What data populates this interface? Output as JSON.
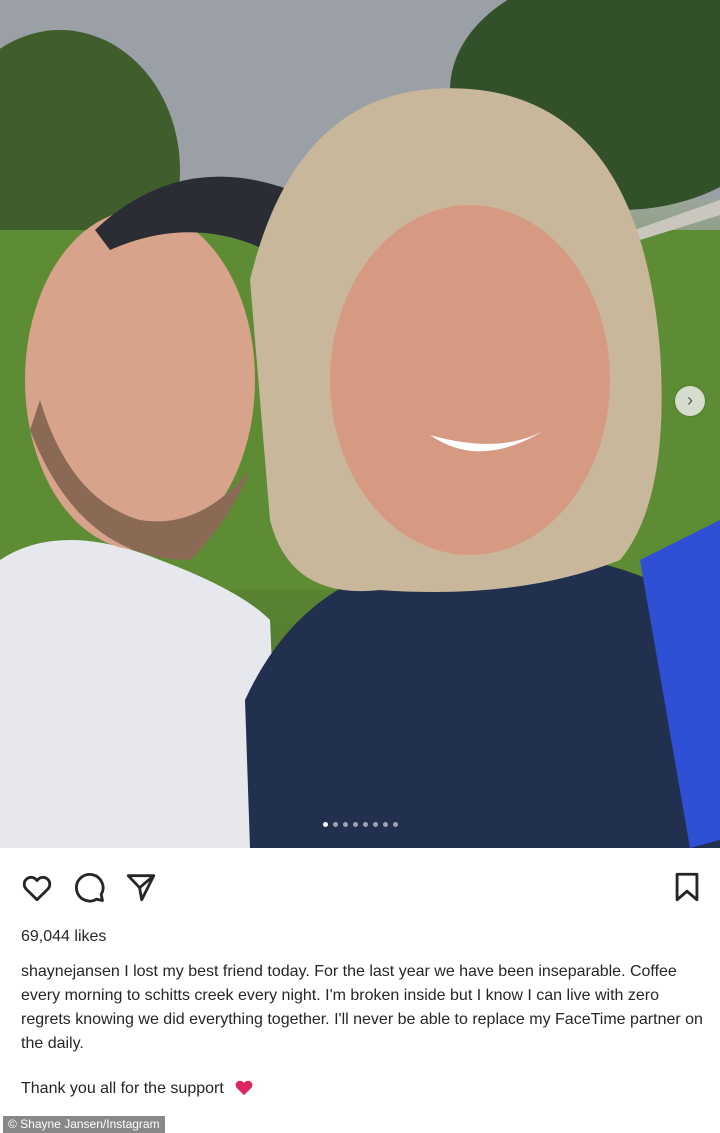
{
  "post": {
    "likes": "69,044 likes",
    "username": "shaynejansen",
    "caption": "I lost my best friend today. For the last year we have been inseparable. Coffee every morning to schitts creek every night. I'm broken inside but I know I can live with zero regrets knowing we did everything together. I'll never be able to replace my FaceTime partner on the daily.",
    "thanks": "Thank you all for the support",
    "carousel": {
      "count": 8,
      "active_index": 0
    }
  },
  "icons": {
    "like": "heart-outline-icon",
    "comment": "comment-bubble-icon",
    "share": "paper-plane-icon",
    "save": "bookmark-icon",
    "next": "chevron-right-icon",
    "emoji": "red-heart-emoji"
  },
  "photo_credit": "© Shayne Jansen/Instagram",
  "colors": {
    "text": "#262626",
    "heart": "#e0245e",
    "credit_bg": "#888888"
  }
}
